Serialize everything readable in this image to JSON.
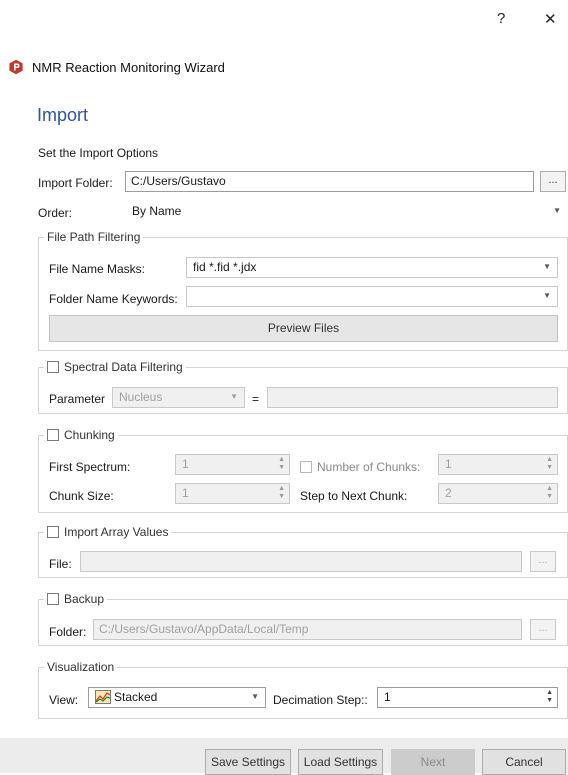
{
  "window": {
    "help_glyph": "?",
    "close_glyph": "✕",
    "title": "NMR Reaction Monitoring Wizard"
  },
  "page": {
    "heading": "Import",
    "subheading": "Set the Import Options"
  },
  "import_folder": {
    "label": "Import Folder:",
    "value": "C:/Users/Gustavo",
    "browse": "..."
  },
  "order": {
    "label": "Order:",
    "value": "By Name"
  },
  "file_path_filtering": {
    "title": "File Path Filtering",
    "masks_label": "File Name Masks:",
    "masks_value": "fid *.fid *.jdx",
    "keywords_label": "Folder Name Keywords:",
    "keywords_value": "",
    "preview_button": "Preview Files"
  },
  "spectral": {
    "title": "Spectral Data Filtering",
    "param_label": "Parameter",
    "param_value": "Nucleus",
    "equals": "=",
    "value": ""
  },
  "chunking": {
    "title": "Chunking",
    "first_label": "First Spectrum:",
    "first_value": "1",
    "num_label": "Number of Chunks:",
    "num_value": "1",
    "size_label": "Chunk Size:",
    "size_value": "1",
    "step_label": "Step to Next Chunk:",
    "step_value": "2"
  },
  "array": {
    "title": "Import Array Values",
    "file_label": "File:",
    "file_value": "",
    "browse": "..."
  },
  "backup": {
    "title": "Backup",
    "folder_label": "Folder:",
    "folder_value": "C:/Users/Gustavo/AppData/Local/Temp",
    "browse": "..."
  },
  "visualization": {
    "title": "Visualization",
    "view_label": "View:",
    "view_value": "Stacked",
    "decimation_label": "Decimation Step::",
    "decimation_value": "1"
  },
  "footer": {
    "save": "Save Settings",
    "load": "Load Settings",
    "next": "Next",
    "cancel": "Cancel"
  }
}
